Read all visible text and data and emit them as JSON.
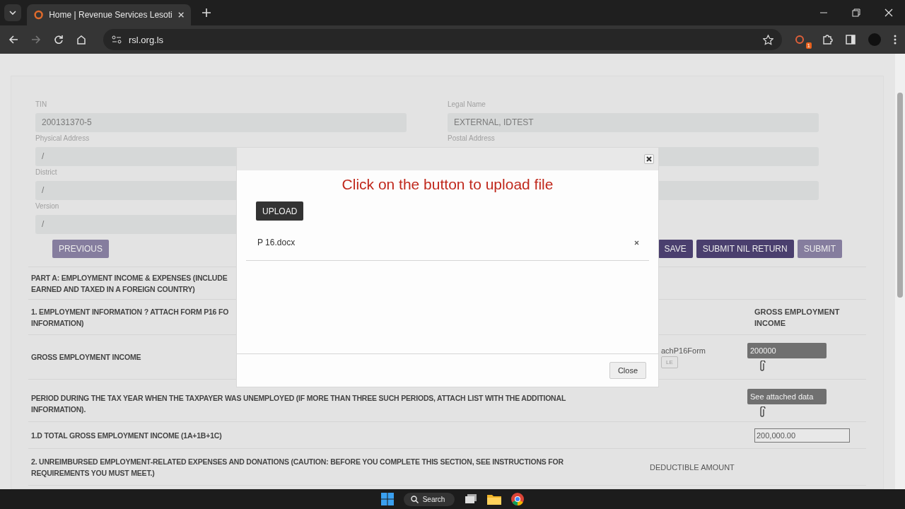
{
  "browser": {
    "tab_title": "Home | Revenue Services Lesoti",
    "url": "rsl.org.ls",
    "extension_badge": "1"
  },
  "form": {
    "left_fields": [
      {
        "label": "TIN",
        "value": "200131370-5"
      },
      {
        "label": "Physical Address",
        "value": "/"
      },
      {
        "label": "District",
        "value": "/"
      },
      {
        "label": "Version",
        "value": "/"
      }
    ],
    "right_fields": [
      {
        "kind": "labeled",
        "label": "Legal Name",
        "value": "EXTERNAL, IDTEST"
      },
      {
        "kind": "labeled",
        "label": "Postal Address"
      },
      {
        "kind": "unlabeled"
      }
    ]
  },
  "previous_button": {
    "label": "PREVIOUS",
    "disabled": true
  },
  "buttons": [
    {
      "label": "SAVE",
      "disabled": false
    },
    {
      "label": "SUBMIT NIL RETURN",
      "disabled": false
    },
    {
      "label": "SUBMIT",
      "disabled": true
    }
  ],
  "rows": [
    {
      "kind": "heading",
      "text": "PART A: EMPLOYMENT INCOME & EXPENSES (INCLUDE\nEARNED AND TAXED IN A FOREIGN COUNTRY)"
    },
    {
      "kind": "heading",
      "text": "1. EMPLOYMENT INFORMATION ? ATTACH FORM P16 FO\nINFORMATION)",
      "column_3": "GROSS EMPLOYMENT\nINCOME"
    },
    {
      "kind": "input",
      "text": "GROSS EMPLOYMENT INCOME",
      "column_2": "achP16Form",
      "column_2_button": "LE",
      "value": "200000",
      "attach": true
    },
    {
      "kind": "input",
      "text": " PERIOD DURING THE TAX YEAR WHEN THE TAXPAYER WAS UNEMPLOYED (IF MORE THAN THREE SUCH PERIODS, ATTACH LIST WITH THE ADDITIONAL\nINFORMATION).",
      "value": "See attached data",
      "attach": true
    },
    {
      "kind": "total",
      "text": "1.D TOTAL GROSS EMPLOYMENT INCOME (1A+1B+1C)",
      "value": "200,000.00"
    },
    {
      "kind": "heading",
      "text": "2. UNREIMBURSED EMPLOYMENT-RELATED EXPENSES AND DONATIONS (CAUTION: BEFORE YOU COMPLETE THIS SECTION, SEE INSTRUCTIONS FOR\nREQUIREMENTS YOU MUST MEET.)",
      "column_2": "DEDUCTIBLE AMOUNT"
    }
  ],
  "modal": {
    "heading": "Click on the button to upload file",
    "upload_button": "UPLOAD",
    "files": [
      {
        "name": "P 16.docx"
      }
    ],
    "close_button": "Close"
  },
  "taskbar": {
    "search": "Search"
  }
}
